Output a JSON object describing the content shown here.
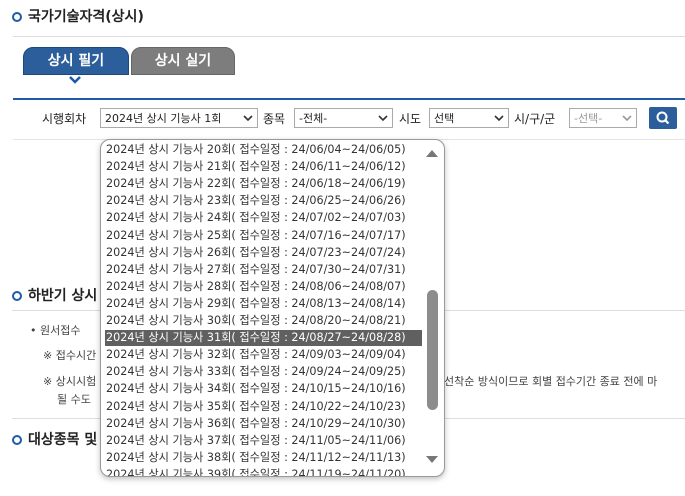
{
  "page": {
    "title": "국가기술자격(상시)"
  },
  "tabs": [
    {
      "label": "상시 필기"
    },
    {
      "label": "상시 실기"
    }
  ],
  "filters": {
    "round_label": "시행회차",
    "round_value": "2024년 상시 기능사 1회",
    "category_label": "종목",
    "category_value": "-전체-",
    "province_label": "시도",
    "province_value": "선택",
    "city_label": "시/구/군",
    "city_value": "-선택-"
  },
  "sections": {
    "half_year": "하반기 상시",
    "targets": "대상종목 및"
  },
  "notes": {
    "apply": "• 원서접수",
    "note1": "※ 접수시간",
    "note2a": "※ 상시시험",
    "note2b": "될 수도",
    "note2c": "선착순 방식이므로 회별 접수기간 종료 전에 마"
  },
  "dropdown": {
    "selected_index": 11,
    "options": [
      "2024년 상시 기능사 20회( 접수일정 : 24/06/04~24/06/05)",
      "2024년 상시 기능사 21회( 접수일정 : 24/06/11~24/06/12)",
      "2024년 상시 기능사 22회( 접수일정 : 24/06/18~24/06/19)",
      "2024년 상시 기능사 23회( 접수일정 : 24/06/25~24/06/26)",
      "2024년 상시 기능사 24회( 접수일정 : 24/07/02~24/07/03)",
      "2024년 상시 기능사 25회( 접수일정 : 24/07/16~24/07/17)",
      "2024년 상시 기능사 26회( 접수일정 : 24/07/23~24/07/24)",
      "2024년 상시 기능사 27회( 접수일정 : 24/07/30~24/07/31)",
      "2024년 상시 기능사 28회( 접수일정 : 24/08/06~24/08/07)",
      "2024년 상시 기능사 29회( 접수일정 : 24/08/13~24/08/14)",
      "2024년 상시 기능사 30회( 접수일정 : 24/08/20~24/08/21)",
      "2024년 상시 기능사 31회( 접수일정 : 24/08/27~24/08/28)",
      "2024년 상시 기능사 32회( 접수일정 : 24/09/03~24/09/04)",
      "2024년 상시 기능사 33회( 접수일정 : 24/09/24~24/09/25)",
      "2024년 상시 기능사 34회( 접수일정 : 24/10/15~24/10/16)",
      "2024년 상시 기능사 35회( 접수일정 : 24/10/22~24/10/23)",
      "2024년 상시 기능사 36회( 접수일정 : 24/10/29~24/10/30)",
      "2024년 상시 기능사 37회( 접수일정 : 24/11/05~24/11/06)",
      "2024년 상시 기능사 38회( 접수일정 : 24/11/12~24/11/13)",
      "2024년 상시 기능사 39회( 접수일정 : 24/11/19~24/11/20)"
    ]
  },
  "colors": {
    "accent": "#1d5aa8",
    "tab_active": "#2b5e9a",
    "tab_inactive": "#7d7d7d",
    "selected_option": "#606060"
  },
  "icons": {
    "search": "search-icon",
    "caret": "chevron-down-icon"
  }
}
